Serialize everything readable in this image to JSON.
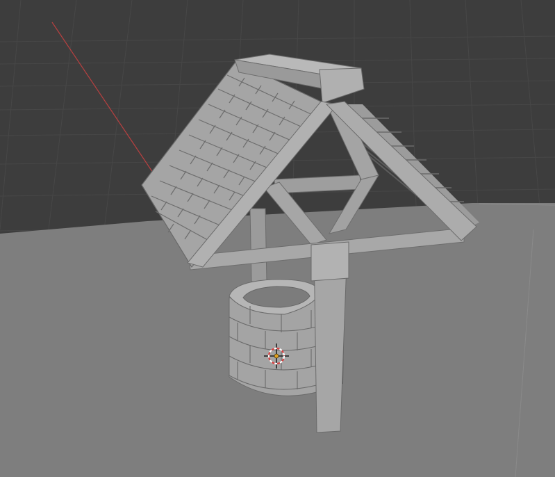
{
  "viewport": {
    "kind": "3d-viewport",
    "background_color": "#3d3d3d",
    "grid_color": "#4a4a4a",
    "x_axis_color": "#c04040",
    "ground_plane_color": "#7e7e7e",
    "model_color": "#a9a9a9"
  },
  "scene": {
    "objects": [
      {
        "name": "well-roof"
      },
      {
        "name": "roof-shingles"
      },
      {
        "name": "well-frame"
      },
      {
        "name": "well-post"
      },
      {
        "name": "stone-well-base"
      }
    ],
    "cursor": {
      "icon": "3d-cursor-icon",
      "ring_colors": [
        "#d84040",
        "#ffffff"
      ],
      "center_color": "#e0a020"
    }
  }
}
